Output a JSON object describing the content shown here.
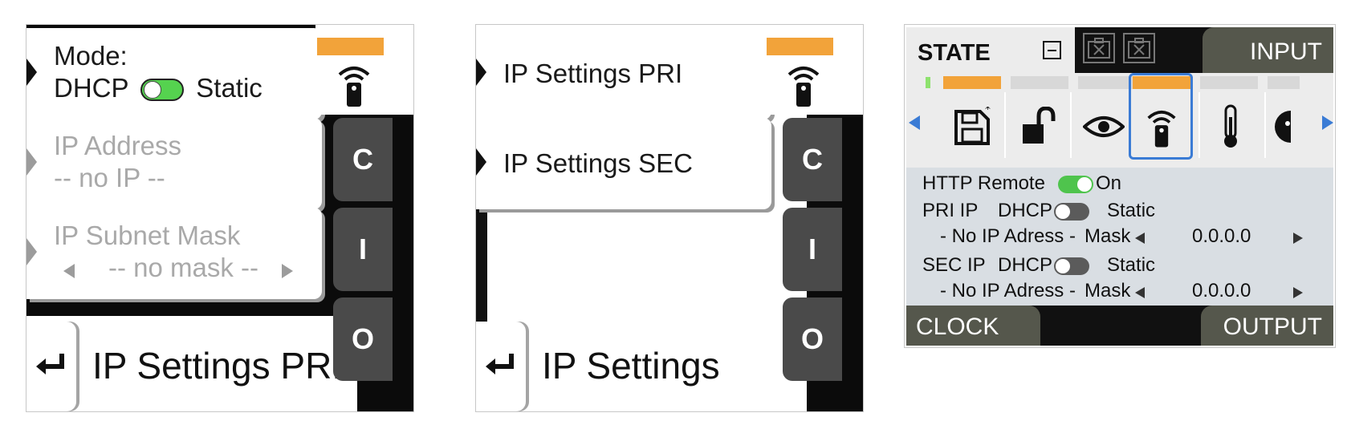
{
  "panel1": {
    "mode_label": "Mode:",
    "dhcp_label": "DHCP",
    "static_label": "Static",
    "mode_toggle_on": true,
    "ip_address_label": "IP Address",
    "ip_address_value": "-- no IP --",
    "subnet_label": "IP Subnet Mask",
    "subnet_value": "-- no mask --",
    "title": "IP Settings PRI",
    "side_keys": [
      "C",
      "I",
      "O"
    ],
    "active_tab_color": "#f2a33a",
    "icon": "wifi-remote-icon"
  },
  "panel2": {
    "item1": "IP Settings PRI",
    "item2": "IP Settings SEC",
    "title": "IP Settings",
    "side_keys": [
      "C",
      "I",
      "O"
    ],
    "icon": "wifi-remote-icon"
  },
  "panel3": {
    "state_title": "STATE",
    "input_tab": "INPUT",
    "clock_tab": "CLOCK",
    "output_tab": "OUTPUT",
    "icons": [
      "save-icon",
      "unlock-icon",
      "eye-icon",
      "wifi-remote-icon",
      "thermometer-icon",
      "partial-icon"
    ],
    "selected_icon_index": 3,
    "http_remote_label": "HTTP Remote",
    "http_remote_state": "On",
    "http_remote_on": true,
    "pri_ip_label": "PRI IP",
    "sec_ip_label": "SEC IP",
    "dhcp_label": "DHCP",
    "static_label": "Static",
    "pri_toggle_on": false,
    "sec_toggle_on": false,
    "no_ip_text": "- No IP Adress -",
    "mask_label": "Mask",
    "pri_mask_value": "0.0.0.0",
    "sec_mask_value": "0.0.0.0"
  }
}
